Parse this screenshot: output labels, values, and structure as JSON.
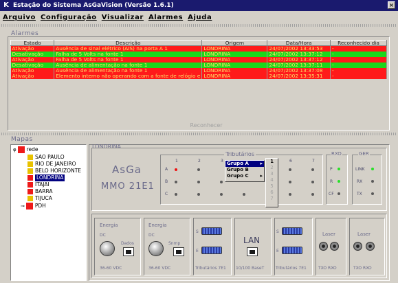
{
  "app": {
    "title": "Estação do Sistema AsGaVision (Versão 1.6.1)",
    "icon": "K"
  },
  "menu": [
    "Arquivo",
    "Configuração",
    "Visualizar",
    "Alarmes",
    "Ajuda"
  ],
  "alarms": {
    "group_label": "Alarmes",
    "columns": [
      "Estado",
      "Descrição",
      "Origem",
      "Data/Hora",
      "Reconhecido dia"
    ],
    "rows": [
      {
        "estado": "Ativação",
        "descricao": "Ausência de sinal elétrico (AIS) na porta  A 1",
        "origem": "LONDRINA",
        "data": "24/07/2002 13:33:53",
        "rec": "-",
        "color": "red"
      },
      {
        "estado": "Desativação",
        "descricao": "Falha de 5 Volts na fonte  1",
        "origem": "LONDRINA",
        "data": "24/07/2002 13:37:12",
        "rec": "-",
        "color": "green"
      },
      {
        "estado": "Ativação",
        "descricao": "Falha de 5 Volts na fonte  1",
        "origem": "LONDRINA",
        "data": "24/07/2002 13:37:12",
        "rec": "-",
        "color": "red"
      },
      {
        "estado": "Desativação",
        "descricao": "Ausência de alimentação na fonte  1",
        "origem": "LONDRINA",
        "data": "24/07/2002 13:37:11",
        "rec": "-",
        "color": "green"
      },
      {
        "estado": "Ativação",
        "descricao": "Ausência de alimentação na fonte  1",
        "origem": "LONDRINA",
        "data": "24/07/2002 13:37:08",
        "rec": "-",
        "color": "red"
      },
      {
        "estado": "Ativação",
        "descricao": "Elemento interno não operando com a fonte de relógio e",
        "origem": "LONDRINA",
        "data": "24/07/2002 13:35:31",
        "rec": "-",
        "color": "red"
      }
    ],
    "ack_button": "Reconhecer"
  },
  "maps": {
    "group_label": "Mapas",
    "tree": {
      "root": "rede",
      "children": [
        "SAO PAULO",
        "RIO DE JANEIRO",
        "BELO HORIZONTE",
        "LONDRINA",
        "ITAJAI",
        "BARRA",
        "TIJUCA"
      ],
      "selected": "LONDRINA",
      "other": "PDH"
    }
  },
  "device": {
    "frame_label": "LONDRINA",
    "brand": "AsGa",
    "model": "MMO 21E1",
    "tributarios_label": "Tributários",
    "columns": [
      "1",
      "2",
      "3",
      "4",
      "5",
      "6",
      "7"
    ],
    "rows": [
      "A",
      "B",
      "C"
    ],
    "rxo_label": "RXO",
    "ger_label": "GER",
    "rxo_leds": [
      "P",
      "R",
      "CF"
    ],
    "ger_leds": [
      "LINK",
      "RX",
      "TX"
    ],
    "context_menu": [
      "Grupo A",
      "Grupo B",
      "Grupo C"
    ],
    "submenu": [
      "1",
      "2",
      "3",
      "4",
      "5",
      "6",
      "7"
    ],
    "ports": {
      "energia1": {
        "title": "Energia",
        "dc": "DC",
        "conn": "Dados",
        "voltage": "36-60 VDC"
      },
      "energia2": {
        "title": "Energia",
        "dc": "DC",
        "conn": "Snmp",
        "voltage": "36-60 VDC"
      },
      "trib1": {
        "s": "S",
        "e": "E",
        "caption": "Tributários 7E1"
      },
      "lan": {
        "title": "LAN",
        "caption": "10/100 BaseT"
      },
      "trib2": {
        "s": "S",
        "e": "E",
        "caption": "Tributários 7E1"
      },
      "rxo": {
        "caption": "TXO  RXO"
      },
      "laser1": {
        "title": "Laser",
        "caption": ""
      },
      "laser2": {
        "title": "Laser",
        "caption": "TXO RXO"
      }
    }
  }
}
